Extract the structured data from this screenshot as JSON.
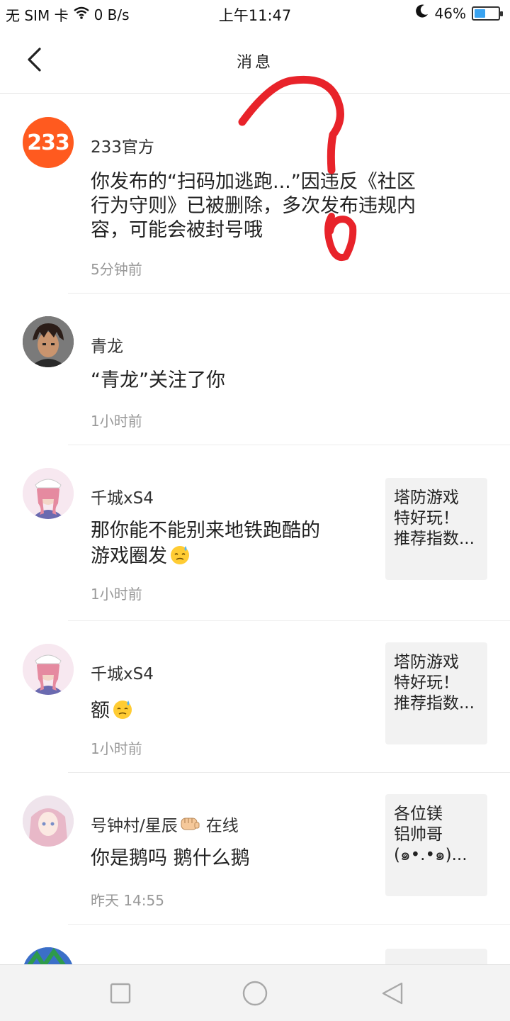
{
  "status_bar": {
    "carrier": "无 SIM 卡",
    "speed": "0 B/s",
    "time": "上午11:47",
    "battery_percent": "46%",
    "battery_level": 0.46,
    "icons": [
      "wifi-icon",
      "moon-icon",
      "battery-icon"
    ]
  },
  "header": {
    "title": "消息",
    "back_icon": "chevron-left-icon"
  },
  "messages": [
    {
      "name": "233官方",
      "avatar_text": "233",
      "text_lines": [
        "你发布的“扫码加逃跑...”因违反《社区",
        "行为守则》已被删除，多次发布违规内",
        "容，可能会被封号哦"
      ],
      "time": "5分钟前"
    },
    {
      "name": "青龙",
      "text_lines": [
        "“青龙”关注了你"
      ],
      "time": "1小时前"
    },
    {
      "name": "千城xS4",
      "text_lines": [
        "那你能不能别来地铁跑酷的",
        "游戏圈发"
      ],
      "time": "1小时前",
      "thumb_lines": [
        "塔防游戏",
        "特好玩！",
        "推荐指数..."
      ]
    },
    {
      "name": "千城xS4",
      "text_lines": [
        "额"
      ],
      "time": "1小时前",
      "thumb_lines": [
        "塔防游戏",
        "特好玩！",
        "推荐指数..."
      ]
    },
    {
      "name": "号钟村/星辰",
      "name_suffix": "在线",
      "text_lines": [
        "你是鹅吗 鹅什么鹅"
      ],
      "time": "昨天 14:55",
      "thumb_lines": [
        "各位镁",
        "铝帅哥",
        "(๑•.•๑)..."
      ]
    }
  ],
  "nav_bar": {
    "icons": [
      "square-icon",
      "circle-icon",
      "triangle-back-icon"
    ]
  },
  "colors": {
    "accent_orange": "#ff5a1f",
    "annotation_red": "#e8232a",
    "battery_blue": "#3aa3f0"
  }
}
